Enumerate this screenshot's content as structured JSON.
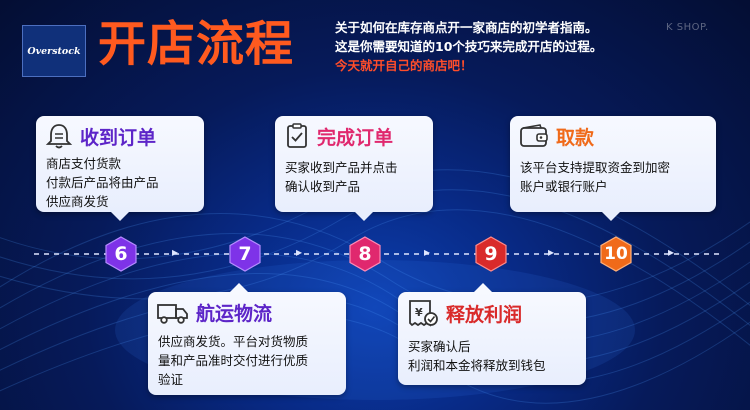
{
  "logo": {
    "text": "Overstock"
  },
  "title": "开店流程",
  "intro": {
    "line1": "关于如何在库存商点开一家商店的初学者指南。",
    "line2": "这是你需要知道的10个技巧来完成开店的过程。",
    "line3": "今天就开自己的商店吧！"
  },
  "watermark": "K SHOP.",
  "colors": {
    "accent": "#ff5a1f",
    "purple": "#7e33e8",
    "pink": "#e0286e",
    "red": "#d92a2a",
    "orange": "#f06a1a",
    "card_title": "#5d25c8"
  },
  "steps": [
    {
      "number": "6",
      "title": "收到订单",
      "icon": "bell-icon",
      "lines": [
        "商店支付货款",
        "付款后产品将由产品",
        "供应商发货"
      ]
    },
    {
      "number": "7",
      "title": "航运物流",
      "icon": "truck-icon",
      "lines": [
        "供应商发货。平台对货物质",
        "量和产品准时交付进行优质",
        "验证"
      ]
    },
    {
      "number": "8",
      "title": "完成订单",
      "icon": "clipboard-icon",
      "lines": [
        "买家收到产品并点击",
        "确认收到产品"
      ]
    },
    {
      "number": "9",
      "title": "释放利润",
      "icon": "receipt-icon",
      "lines": [
        "买家确认后",
        "利润和本金将释放到钱包"
      ]
    },
    {
      "number": "10",
      "title": "取款",
      "icon": "wallet-icon",
      "lines": [
        "该平台支持提取资金到加密",
        "账户或银行账户"
      ]
    }
  ]
}
